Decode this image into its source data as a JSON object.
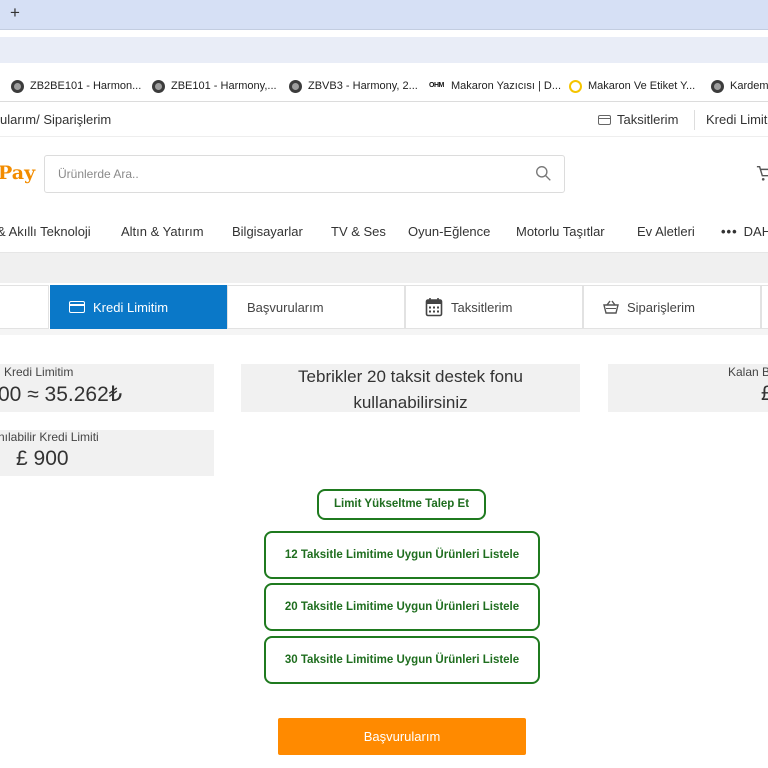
{
  "browser": {
    "new_tab_glyph": "+",
    "bookmarks": [
      {
        "label": "ZB2BE101 - Harmon...",
        "icon": "globe-icon"
      },
      {
        "label": "ZBE101 - Harmony,...",
        "icon": "globe-icon"
      },
      {
        "label": "ZBVB3 - Harmony, 2...",
        "icon": "globe-icon"
      },
      {
        "label": "Makaron Yazıcısı | D...",
        "icon": "brand-logo-icon",
        "logo_text": "OHM"
      },
      {
        "label": "Makaron Ve Etiket Y...",
        "icon": "ring-icon"
      },
      {
        "label": "Kardem",
        "icon": "globe-icon"
      }
    ]
  },
  "topbar": {
    "breadcrumb": "ularım/ Siparişlerim",
    "installments_link": "Taksitlerim",
    "credit_limit_link": "Kredi Limit"
  },
  "header": {
    "brand": "Pay",
    "search_placeholder": "Ürünlerde Ara.."
  },
  "categories": [
    "& Akıllı Teknoloji",
    "Altın & Yatırım",
    "Bilgisayarlar",
    "TV & Ses",
    "Oyun-Eğlence",
    "Motorlu Taşıtlar",
    "Ev Aletleri",
    "DAH"
  ],
  "tabs": {
    "credit_limit": "Kredi Limitim",
    "applications": "Başvurularım",
    "installments": "Taksitlerim",
    "orders": "Siparişlerim"
  },
  "boxes": {
    "credit_limit_label": "Kredi Limitim",
    "credit_limit_value": "00 ≈ 35.262₺",
    "usable_limit_label": "nılabilir Kredi Limiti",
    "usable_limit_value": "£ 900",
    "message": "Tebrikler 20 taksit destek fonu kullanabilirsiniz",
    "remaining_label": "Kalan B",
    "remaining_value": "£"
  },
  "buttons": {
    "limit_increase": "Limit Yükseltme Talep Et",
    "list_12": "12 Taksitle Limitime Uygun Ürünleri Listele",
    "list_20": "20 Taksitle Limitime Uygun Ürünleri Listele",
    "list_30": "30 Taksitle Limitime Uygun Ürünleri Listele",
    "applications": "Başvurularım"
  },
  "colors": {
    "accent_blue": "#0a78c8",
    "brand_orange": "#f28c00",
    "button_orange": "#ff8a00",
    "success_green": "#1f7a1f"
  }
}
